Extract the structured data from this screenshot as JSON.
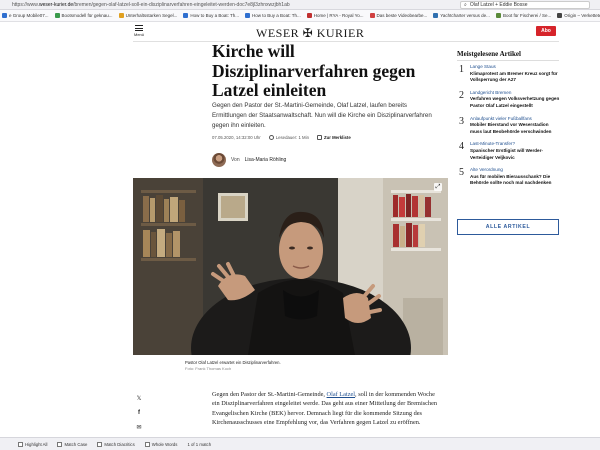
{
  "browser": {
    "url_prefix": "https://www.",
    "url_domain": "weser-kurier.de",
    "url_rest": "/bremen/gegen-olaf-latzel-soll-ein-disziplinarverfahren-eingeleitet-werden-doc7e8jl3zhnxwzjbh1ab",
    "find_query": "Olaf Latzel + Eddie Bosse",
    "bookmarks": [
      {
        "label": "e Group Mobile07...",
        "color": "#2f6fcf"
      },
      {
        "label": "Bootsmodell für geknau...",
        "color": "#3a9a4b"
      },
      {
        "label": "Unterhaltsstarken Segel...",
        "color": "#e0a020"
      },
      {
        "label": "How to Buy a Boat: Th...",
        "color": "#2f6fcf"
      },
      {
        "label": "How to Buy a Boat: Th...",
        "color": "#2f6fcf"
      },
      {
        "label": "Home | RYA - Royal Yo...",
        "color": "#c03030"
      },
      {
        "label": "Das beste Videobearbe...",
        "color": "#d04040"
      },
      {
        "label": "Yachtcharter versus de...",
        "color": "#3070b0"
      },
      {
        "label": "Boot für Fischerei / Se...",
        "color": "#5a8a3a"
      },
      {
        "label": "Origin – Verkettete…",
        "color": "#444444"
      },
      {
        "label": "Le color ANTARCTIC...",
        "color": "#e06020"
      },
      {
        "label": "LaMO Voll...",
        "color": "#2f6fcf"
      }
    ]
  },
  "header": {
    "menu_label": "Menü",
    "logo": "WESER ✠ KURIER",
    "abo_label": "Abo"
  },
  "article": {
    "headline": "Kirche will Disziplinarverfahren gegen Latzel einleiten",
    "lead": "Gegen den Pastor der St.-Martini-Gemeinde, Olaf Latzel, laufen bereits Ermittlungen der Staatsanwaltschaft. Nun will die Kirche ein Disziplinarverfahren gegen ihn einleiten.",
    "date": "07.05.2020, 14:32:00 Uhr",
    "read_time_label": "Lesedauer:",
    "read_time": "1 Min",
    "watchlist_label": "Zur Merkliste",
    "author_prefix": "Von",
    "author_name": "Lisa-Maria Röhling",
    "caption": "Pastor Olaf Latzel erwartet ein Disziplinarverfahren.",
    "credit": "Foto: Frank Thomas Koch",
    "body_start": "Gegen den Pastor der St.-Martini-Gemeinde,",
    "body_link": "Olaf Latzel",
    "body_rest": ", soll in der kommenden Woche ein Disziplinarverfahren eingeleitet werde. Das geht aus einer Mitteilung der Bremischen Evangelischen Kirche (BEK) hervor. Demnach liegt für die kommende Sitzung des Kirchenausschusses eine Empfehlung vor, das Verfahren gegen Latzel zu eröffnen."
  },
  "share": {
    "x_icon": "𝕏",
    "facebook_icon": "f",
    "mail_icon": "✉"
  },
  "sidebar": {
    "title": "Meistgelesene Artikel",
    "items": [
      {
        "num": "1",
        "kicker": "Lange Staus",
        "title": "Klimaprotest am Bremer Kreuz sorgt für Vollsperrung der A27"
      },
      {
        "num": "2",
        "kicker": "Landgericht Bremen",
        "title": "Verfahren wegen Volksverhetzung gegen Pastor Olaf Latzel eingestellt"
      },
      {
        "num": "3",
        "kicker": "Anlaufpunkt vieler Fußballfans",
        "title": "Mobiler Bierstand vor Weserstadion muss laut Beobehörde verschwinden"
      },
      {
        "num": "4",
        "kicker": "Last-Minute-Transfer?",
        "title": "Spanischer Erstligist will Werder-Verteidiger Veljkovic"
      },
      {
        "num": "5",
        "kicker": "Alte Verordnung",
        "title": "Aus für mobilen Bierausschank? Die Behörde sollte noch mal nachdenken"
      }
    ],
    "all_label": "ALLE ARTIKEL"
  },
  "findbar": {
    "highlight_all": "Highlight All",
    "match_case": "Match Case",
    "match_diacritics": "Match Diacritics",
    "whole_words": "Whole Words",
    "result": "1 of 1 match"
  }
}
